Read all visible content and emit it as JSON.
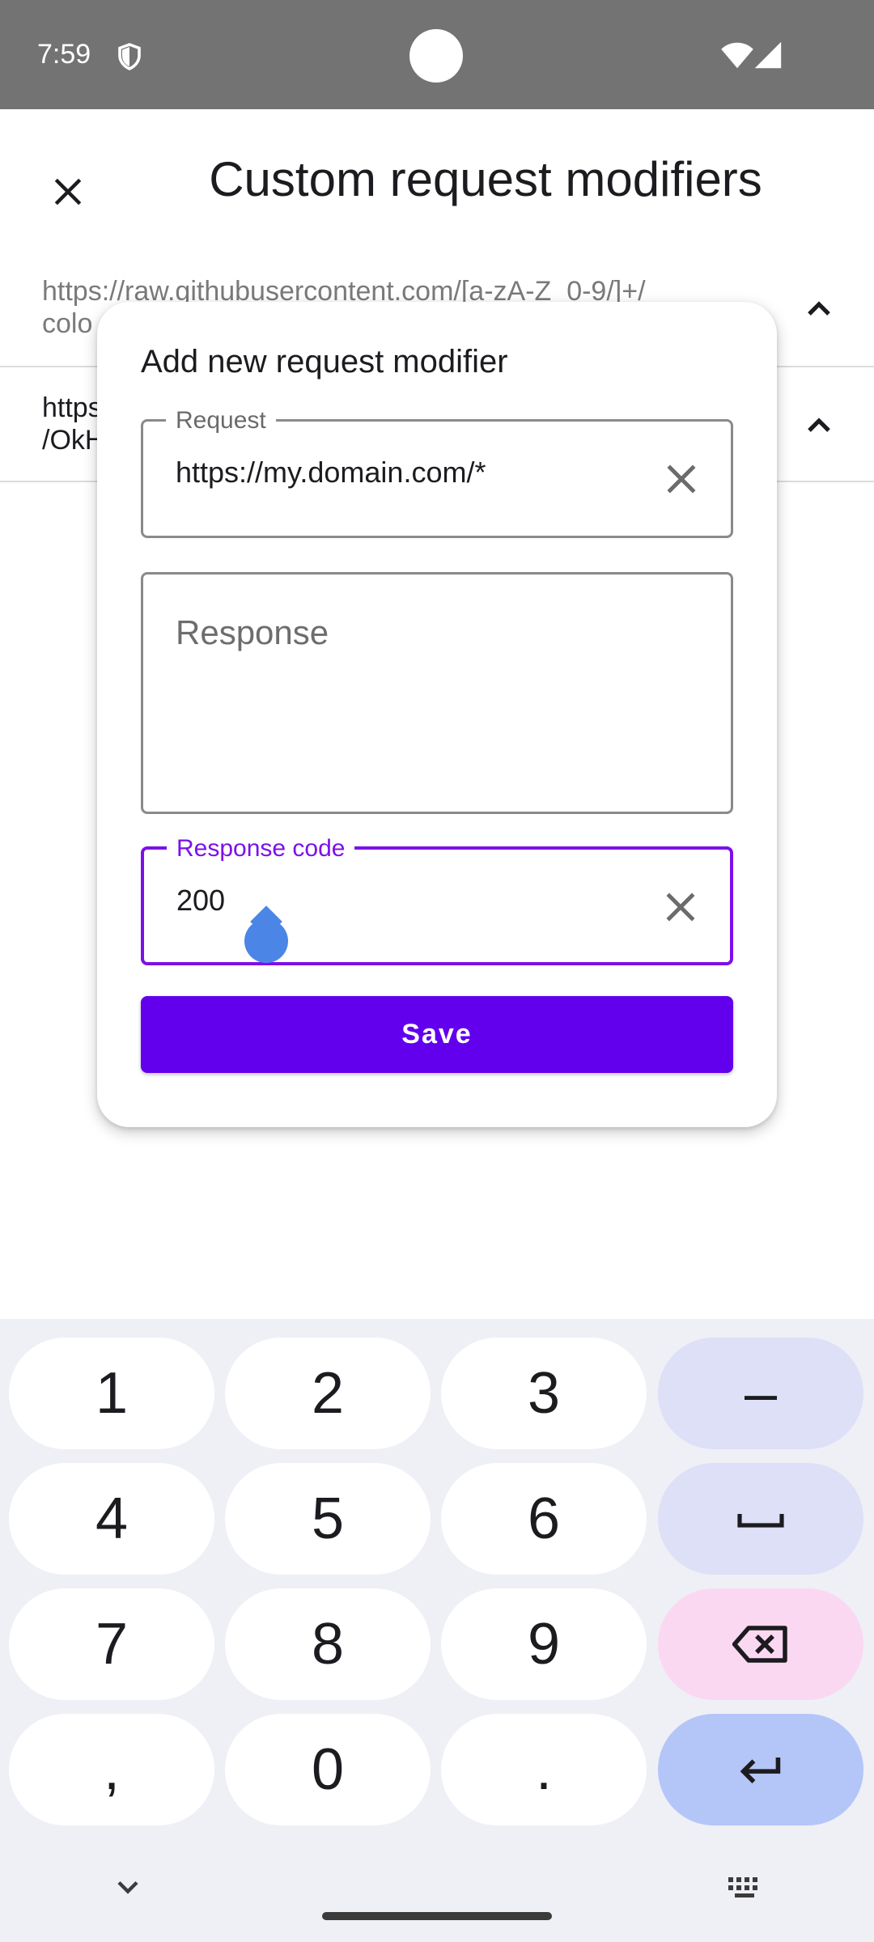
{
  "status_bar": {
    "time": "7:59",
    "icons": [
      "shield-icon",
      "wifi-icon",
      "signal-icon"
    ]
  },
  "app_bar": {
    "title": "Custom request modifiers",
    "close_icon": "close-icon"
  },
  "rules": [
    {
      "text": "https://raw.githubusercontent.com/[a-zA-Z_0-9/]+/\ncolo",
      "icon": "chevron-up-icon"
    },
    {
      "text": "https:\n/OkH",
      "icon": "chevron-up-icon"
    }
  ],
  "dialog": {
    "title": "Add new request modifier",
    "request": {
      "label": "Request",
      "value": "https://my.domain.com/*"
    },
    "response": {
      "placeholder": "Response"
    },
    "response_code": {
      "label": "Response code",
      "value": "200"
    },
    "save_label": "Save",
    "accent_color": "#6200ee"
  },
  "keyboard": {
    "keys": [
      [
        "1",
        "2",
        "3",
        "–"
      ],
      [
        "4",
        "5",
        "6",
        "space"
      ],
      [
        "7",
        "8",
        "9",
        "backspace"
      ],
      [
        ",",
        "0",
        ".",
        "enter"
      ]
    ]
  }
}
